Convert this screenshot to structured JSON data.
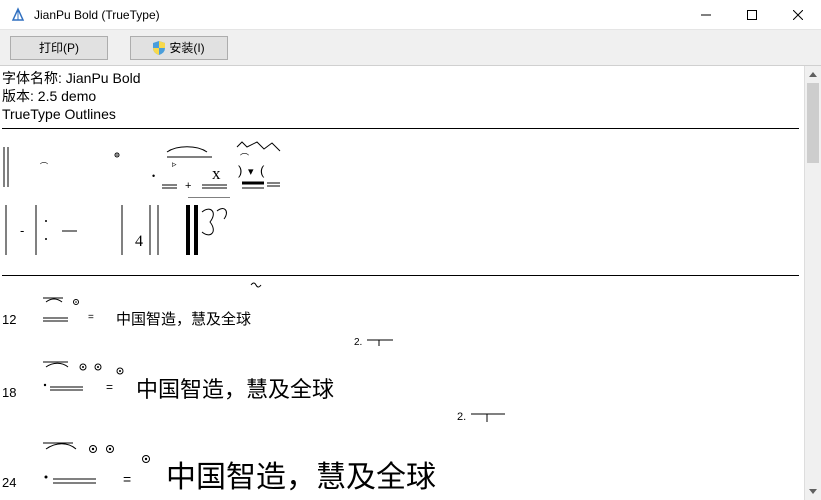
{
  "window": {
    "title": "JianPu Bold (TrueType)"
  },
  "toolbar": {
    "print_label": "打印(P)",
    "install_label": "安装(I)"
  },
  "meta": {
    "font_name_label": "字体名称: JianPu Bold",
    "version_label": "版本: 2.5 demo",
    "outlines_label": "TrueType Outlines"
  },
  "samples": {
    "text": "中国智造，慧及全球",
    "sizes": [
      "12",
      "18",
      "24"
    ],
    "annot2": "2."
  },
  "glyphs": {
    "x_char": "x",
    "four_char": "4"
  }
}
